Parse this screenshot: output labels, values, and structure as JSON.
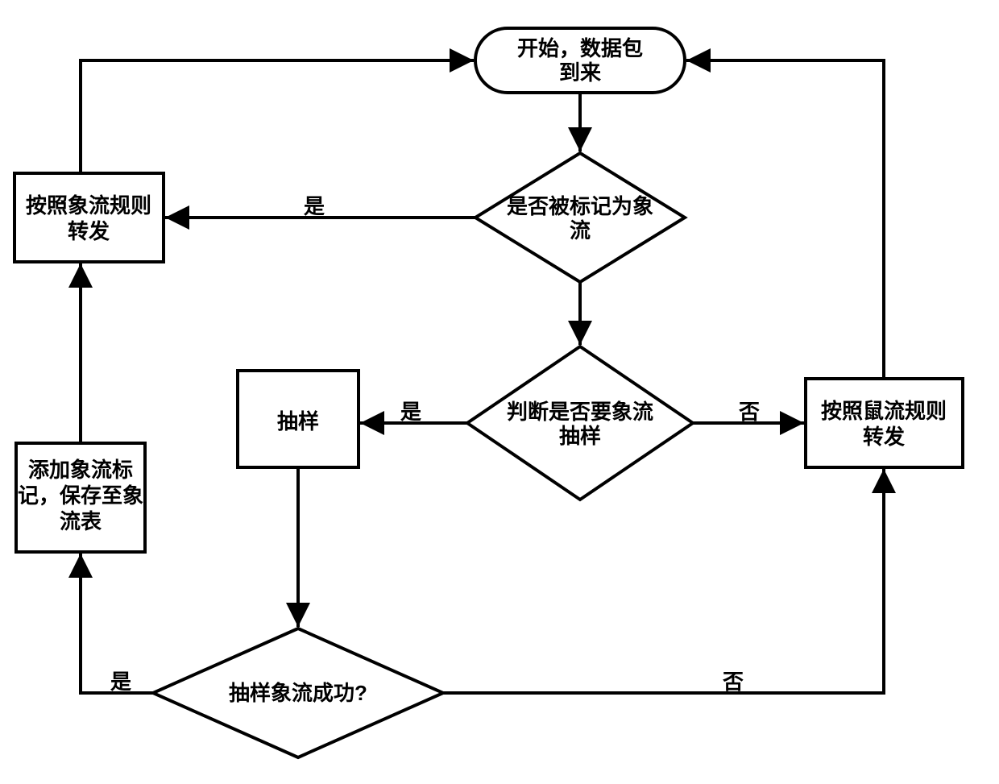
{
  "nodes": {
    "start": {
      "line1": "开始，数据包",
      "line2": "到来"
    },
    "markedQ": {
      "line1": "是否被标记为象",
      "line2": "流"
    },
    "sampleQ": {
      "line1": "判断是否要象流",
      "line2": "抽样"
    },
    "sample": {
      "label": "抽样"
    },
    "successQ": {
      "label": "抽样象流成功?"
    },
    "addMark": {
      "line1": "添加象流标",
      "line2": "记，保存至象",
      "line3": "流表"
    },
    "forwardElep": {
      "line1": "按照象流规则",
      "line2": "转发"
    },
    "forwardMouse": {
      "line1": "按照鼠流规则",
      "line2": "转发"
    }
  },
  "edges": {
    "yes": "是",
    "no": "否"
  }
}
